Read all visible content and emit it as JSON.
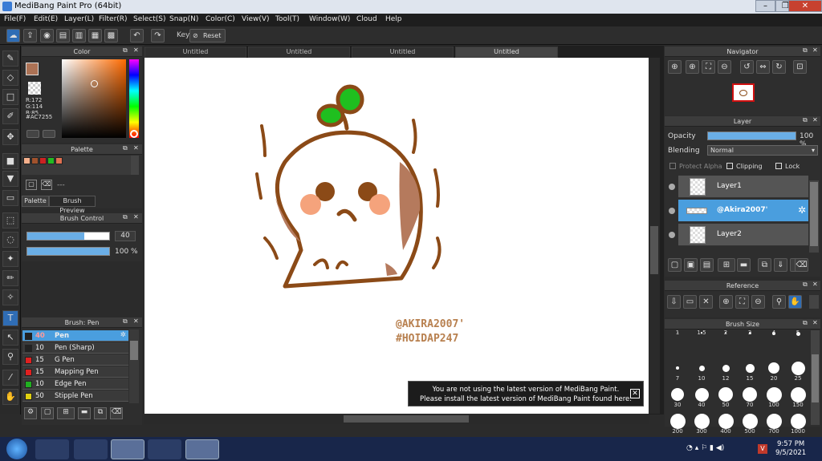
{
  "window": {
    "title": "MediBang Paint Pro (64bit)",
    "min": "–",
    "max": "❐",
    "close": "✕"
  },
  "menu": [
    "File(F)",
    "Edit(E)",
    "Layer(L)",
    "Filter(R)",
    "Select(S)",
    "Snap(N)",
    "Color(C)",
    "View(V)",
    "Tool(T)",
    "Window(W)",
    "Cloud",
    "Help"
  ],
  "toolbar": {
    "key_label": "Key",
    "reset_label": "Reset"
  },
  "color_panel": {
    "title": "Color",
    "r": "R:172",
    "g": "G:114",
    "b": "B:85",
    "hex": "#AC7255",
    "fg": "#ac7255",
    "bg": "#ffffff"
  },
  "palette_panel": {
    "title": "Palette",
    "tabs": [
      "Palette",
      "Brush Preview"
    ],
    "swatches": [
      "#f5b08c",
      "#a0522d",
      "#cc2222",
      "#22bb22",
      "#e07050"
    ],
    "dash": "---"
  },
  "brush_control": {
    "title": "Brush Control",
    "size": "40",
    "size_fraction": 0.7,
    "opacity": "100 %",
    "opacity_fraction": 1.0
  },
  "brush_list": {
    "title": "Brush: Pen",
    "items": [
      {
        "size": "40",
        "name": "Pen",
        "color": "#222222"
      },
      {
        "size": "10",
        "name": "Pen (Sharp)",
        "color": "#222222"
      },
      {
        "size": "15",
        "name": "G Pen",
        "color": "#e02020"
      },
      {
        "size": "15",
        "name": "Mapping Pen",
        "color": "#e02020"
      },
      {
        "size": "10",
        "name": "Edge Pen",
        "color": "#20b020"
      },
      {
        "size": "50",
        "name": "Stipple Pen",
        "color": "#e0d010"
      }
    ]
  },
  "canvas_tabs": [
    "Untitled",
    "Untitled",
    "Untitled",
    "Untitled"
  ],
  "canvas_text": {
    "line1": "@AKIRA2007'",
    "line2": "#HOIDAP247"
  },
  "notice": {
    "line1": "You are not using the latest version of MediBang Paint.",
    "line2": "Please install the latest version of MediBang Paint found here.",
    "close": "✕"
  },
  "navigator": {
    "title": "Navigator"
  },
  "layer_panel": {
    "title": "Layer",
    "opacity_label": "Opacity",
    "opacity_value": "100 %",
    "opacity_fraction": 1.0,
    "blending_label": "Blending",
    "blending_value": "Normal",
    "protect_alpha": "Protect Alpha",
    "clipping": "Clipping",
    "lock": "Lock",
    "layers": [
      {
        "name": "Layer1",
        "selected": false
      },
      {
        "name": "@Akira2007'",
        "selected": true
      },
      {
        "name": "Layer2",
        "selected": false
      }
    ]
  },
  "reference": {
    "title": "Reference"
  },
  "brush_size": {
    "title": "Brush Size",
    "rows": [
      [
        "1",
        "1.5",
        "2",
        "3",
        "4",
        "5"
      ],
      [
        "7",
        "10",
        "12",
        "15",
        "20",
        "25"
      ],
      [
        "30",
        "40",
        "50",
        "70",
        "100",
        "150"
      ],
      [
        "200",
        "300",
        "400",
        "500",
        "700",
        "1000"
      ]
    ]
  },
  "taskbar": {
    "time": "9:57 PM",
    "date": "9/5/2021",
    "lang": "V"
  },
  "colors": {
    "accent": "#4a9ede",
    "brown": "#8b4a17",
    "leaf": "#1fbf1f",
    "blush": "#f5a37c"
  }
}
